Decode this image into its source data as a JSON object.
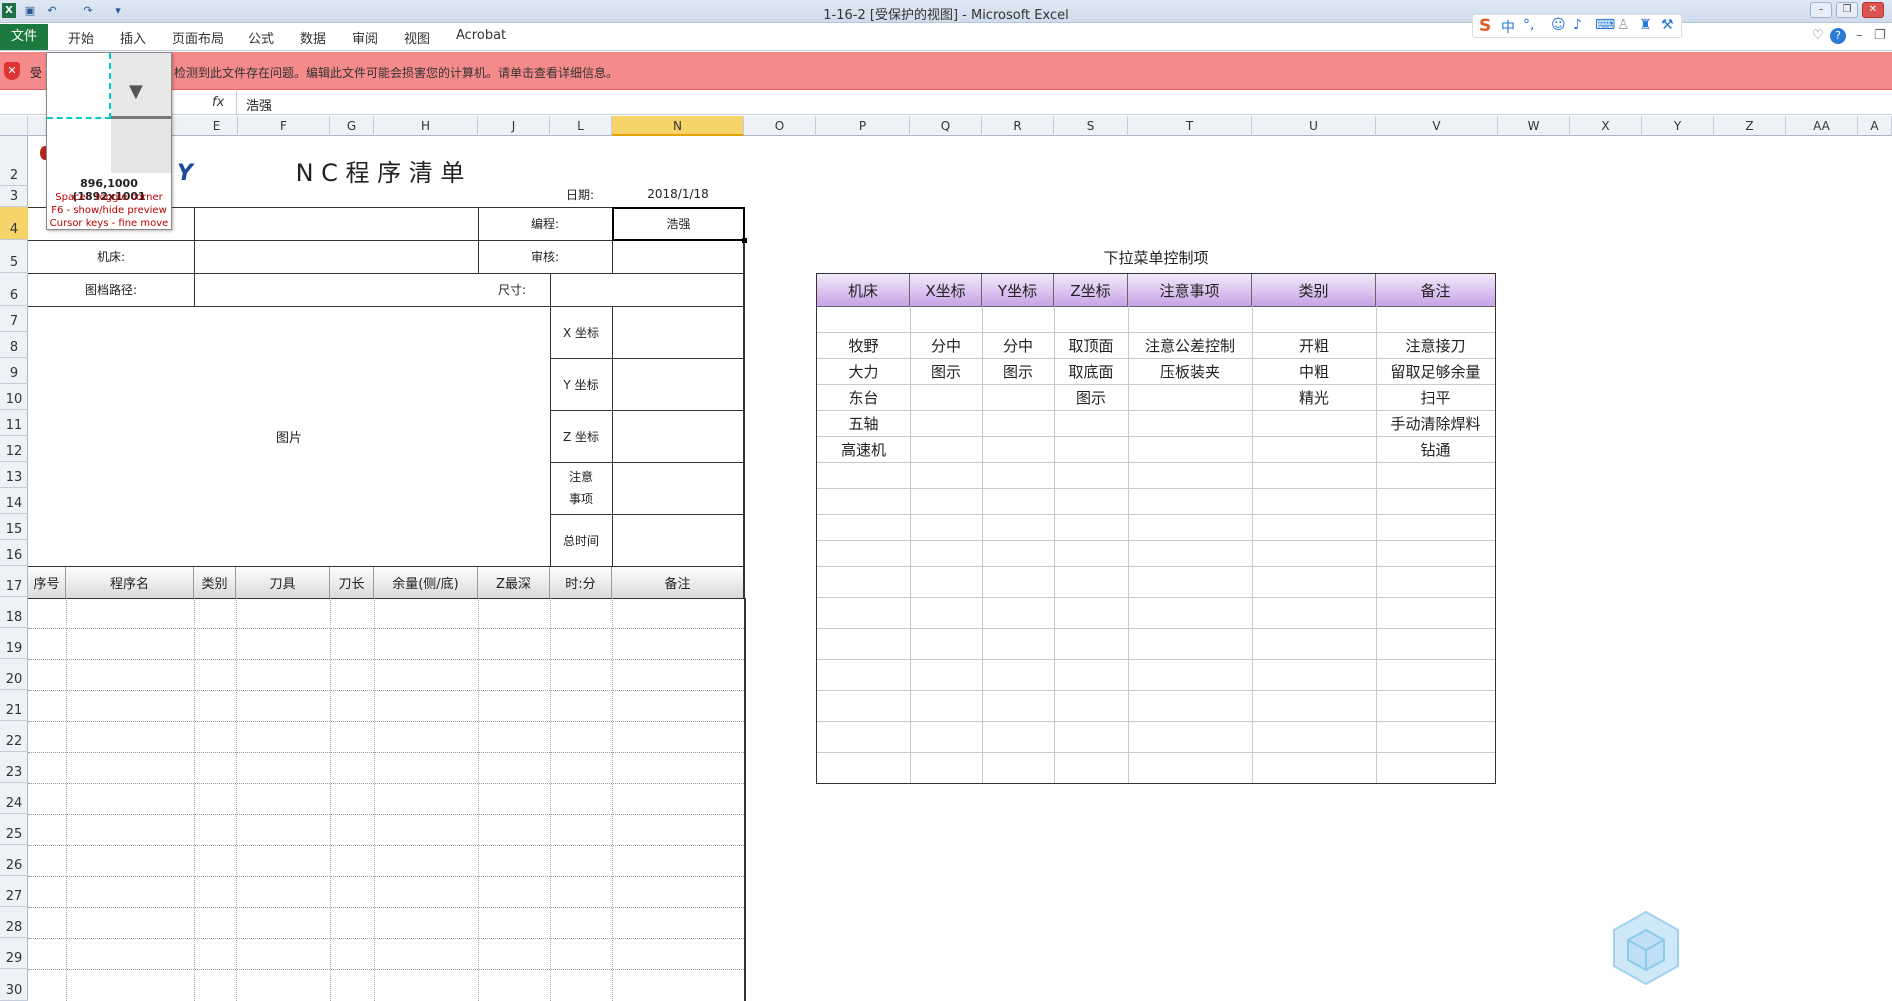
{
  "window": {
    "title": "1-16-2  [受保护的视图]  -  Microsoft Excel"
  },
  "ribbon": {
    "file_tab": "文件",
    "tabs": [
      "开始",
      "插入",
      "页面布局",
      "公式",
      "数据",
      "审阅",
      "视图",
      "Acrobat"
    ]
  },
  "ime_toolbar": {
    "logo": "S",
    "lang": "中",
    "punct": "°,"
  },
  "warning_bar": {
    "message": "检测到此文件存在问题。编辑此文件可能会损害您的计算机。请单击查看详细信息。",
    "prefix": "受"
  },
  "formula_bar": {
    "fx_label": "fx",
    "value": "浩强"
  },
  "column_headers": [
    "E",
    "F",
    "G",
    "H",
    "J",
    "L",
    "N",
    "O",
    "P",
    "Q",
    "R",
    "S",
    "T",
    "U",
    "V",
    "W",
    "X",
    "Y",
    "Z",
    "AA",
    "A"
  ],
  "selected_column": "N",
  "row_headers": [
    "2",
    "3",
    "4",
    "5",
    "6",
    "7",
    "8",
    "9",
    "10",
    "11",
    "12",
    "13",
    "14",
    "15",
    "16",
    "17",
    "18",
    "19",
    "20",
    "21",
    "22",
    "23",
    "24",
    "25",
    "26",
    "27",
    "28",
    "29",
    "30"
  ],
  "selected_row": "4",
  "magnifier": {
    "coords": "896,1000 (1892x1001",
    "hint1": "Space - toggle corner",
    "hint2": "F6 - show/hide preview",
    "hint3": "Cursor keys - fine move"
  },
  "sheet": {
    "logo_fragment": "Y",
    "title": "N C 程 序 清 单",
    "date_label": "日期:",
    "date_value": "2018/1/18",
    "programmer_label": "编程:",
    "programmer_value": "浩强",
    "machine_label": "机床:",
    "reviewer_label": "审核:",
    "path_label": "图档路径:",
    "size_label": "尺寸:",
    "x_label": "X 坐标",
    "y_label": "Y 坐标",
    "z_label": "Z 坐标",
    "notes_label_1": "注意",
    "notes_label_2": "事项",
    "total_time_label": "总时间",
    "picture_label": "图片",
    "program_headers": [
      "序号",
      "程序名",
      "类别",
      "刀具",
      "刀长",
      "余量(侧/底)",
      "Z最深",
      "时:分",
      "备注"
    ]
  },
  "dropdown_table": {
    "title": "下拉菜单控制项",
    "headers": [
      "机床",
      "X坐标",
      "Y坐标",
      "Z坐标",
      "注意事项",
      "类别",
      "备注"
    ],
    "rows": [
      [
        "",
        "",
        "",
        "",
        "",
        "",
        ""
      ],
      [
        "牧野",
        "分中",
        "分中",
        "取顶面",
        "注意公差控制",
        "开粗",
        "注意接刀"
      ],
      [
        "大力",
        "图示",
        "图示",
        "取底面",
        "压板装夹",
        "中粗",
        "留取足够余量"
      ],
      [
        "东台",
        "",
        "",
        "图示",
        "",
        "精光",
        "扫平"
      ],
      [
        "五轴",
        "",
        "",
        "",
        "",
        "",
        "手动清除焊料"
      ],
      [
        "高速机",
        "",
        "",
        "",
        "",
        "",
        "钻通"
      ]
    ]
  }
}
